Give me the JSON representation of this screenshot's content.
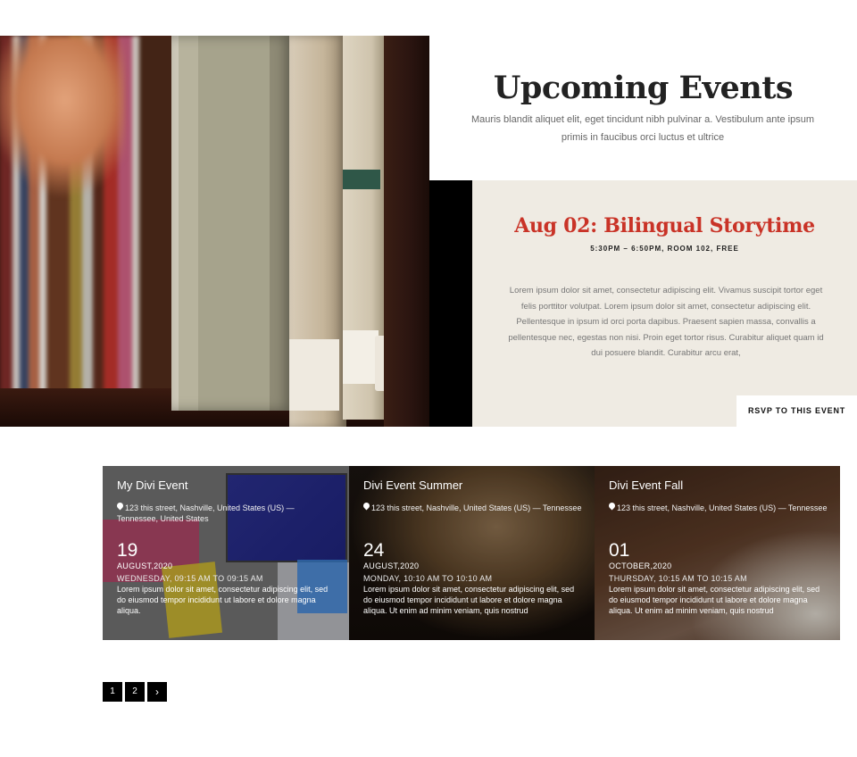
{
  "header": {
    "title": "Upcoming Events",
    "subtitle": "Mauris blandit aliquet elit, eget tincidunt nibh pulvinar a. Vestibulum ante ipsum primis in faucibus orci luctus et ultrice"
  },
  "featured": {
    "title": "Aug 02: Bilingual Storytime",
    "meta": "5:30PM – 6:50PM, ROOM 102, FREE",
    "description": "Lorem ipsum dolor sit amet, consectetur adipiscing elit. Vivamus suscipit tortor eget felis porttitor volutpat. Lorem ipsum dolor sit amet, consectetur adipiscing elit. Pellentesque in ipsum id orci porta dapibus. Praesent sapien massa, convallis a pellentesque nec, egestas non nisi. Proin eget tortor risus. Curabitur aliquet quam id dui posuere blandit. Curabitur arcu erat,",
    "rsvp_label": "RSVP TO THIS EVENT",
    "accent_color": "#c93327"
  },
  "events": [
    {
      "title": "My Divi Event",
      "address": "123 this street, Nashville, United States (US) — Tennessee, United States",
      "day": "19",
      "month_year": "AUGUST,2020",
      "time": "WEDNESDAY, 09:15 AM TO 09:15 AM",
      "description": "Lorem ipsum dolor sit amet, consectetur adipiscing elit, sed do eiusmod tempor incididunt ut labore et dolore magna aliqua."
    },
    {
      "title": "Divi Event Summer",
      "address": "123 this street, Nashville, United States (US) — Tennessee",
      "day": "24",
      "month_year": "AUGUST,2020",
      "time": "MONDAY, 10:10 AM TO 10:10 AM",
      "description": "Lorem ipsum dolor sit amet, consectetur adipiscing elit, sed do eiusmod tempor incididunt ut labore et dolore magna aliqua. Ut enim ad minim veniam, quis nostrud"
    },
    {
      "title": "Divi Event Fall",
      "address": "123 this street, Nashville, United States (US) — Tennessee",
      "day": "01",
      "month_year": "OCTOBER,2020",
      "time": "THURSDAY, 10:15 AM TO 10:15 AM",
      "description": "Lorem ipsum dolor sit amet, consectetur adipiscing elit, sed do eiusmod tempor incididunt ut labore et dolore magna aliqua. Ut enim ad minim veniam, quis nostrud"
    }
  ],
  "pagination": {
    "pages": [
      "1",
      "2"
    ],
    "next_label": "›"
  }
}
